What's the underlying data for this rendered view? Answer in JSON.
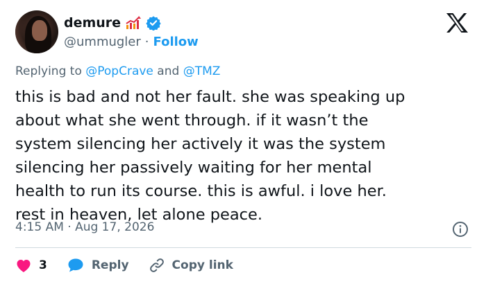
{
  "author": {
    "display_name": "demure",
    "handle": "@ummugler",
    "separator": "·",
    "follow_label": "Follow",
    "verified_color": "#1d9bf0"
  },
  "brand": {
    "logo": "x-logo-icon"
  },
  "reply_context": {
    "prefix": "Replying to",
    "mention_1": "@PopCrave",
    "conjunction": "and",
    "mention_2": "@TMZ"
  },
  "tweet": {
    "text": "this is bad and not her fault. she was speaking up\nabout what she went through. if it wasn’t the\nsystem silencing her actively it was the system\nsilencing her passively waiting for her mental\nhealth to run its course. this is awful. i love her.\nrest in heaven, let alone peace.",
    "timestamp": "4:15 AM · Aug 17, 2026"
  },
  "actions": {
    "like_count": "3",
    "reply_label": "Reply",
    "copy_link_label": "Copy link"
  },
  "colors": {
    "accent": "#1d9bf0",
    "like": "#f91880",
    "text": "#0f1419",
    "muted": "#536471"
  }
}
